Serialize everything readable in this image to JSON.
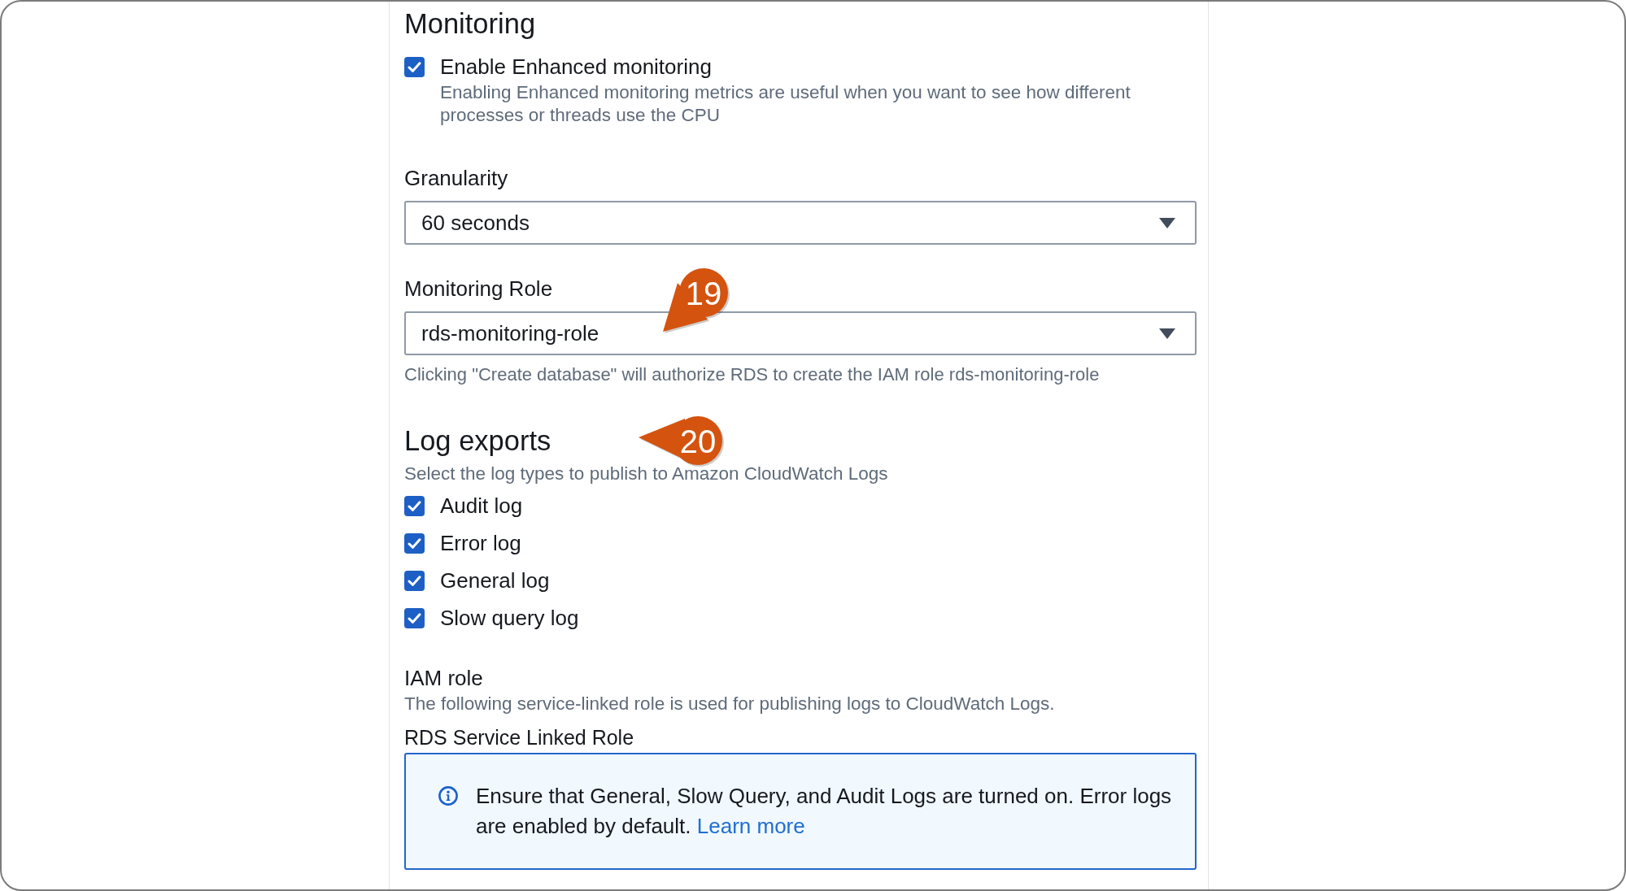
{
  "monitoring": {
    "heading": "Monitoring",
    "enhanced_monitoring": {
      "label": "Enable Enhanced monitoring",
      "checked": true,
      "description": "Enabling Enhanced monitoring metrics are useful when you want to see how different processes or threads use the CPU"
    },
    "fields": [
      {
        "label": "Granularity",
        "value": "60 seconds"
      },
      {
        "label": "Monitoring Role",
        "value": "rds-monitoring-role",
        "hint": "Clicking \"Create database\" will authorize RDS to create the IAM role rds-monitoring-role",
        "callout": {
          "label": "19",
          "kind": "southwest"
        }
      }
    ]
  },
  "log_exports": {
    "heading": "Log exports",
    "callout": {
      "label": "20",
      "kind": "west"
    },
    "description": "Select the log types to publish to Amazon CloudWatch Logs",
    "log_types": [
      {
        "label": "Audit log",
        "checked": true
      },
      {
        "label": "Error log",
        "checked": true
      },
      {
        "label": "General log",
        "checked": true
      },
      {
        "label": "Slow query log",
        "checked": true
      }
    ],
    "iam_role": {
      "label": "IAM role",
      "description": "The following service-linked role is used for publishing logs to CloudWatch Logs.",
      "role_name": "RDS Service Linked Role"
    },
    "info_alert": {
      "text": "Ensure that General, Slow Query, and Audit Logs are turned on. Error logs are enabled by default.",
      "link": "Learn more"
    }
  }
}
